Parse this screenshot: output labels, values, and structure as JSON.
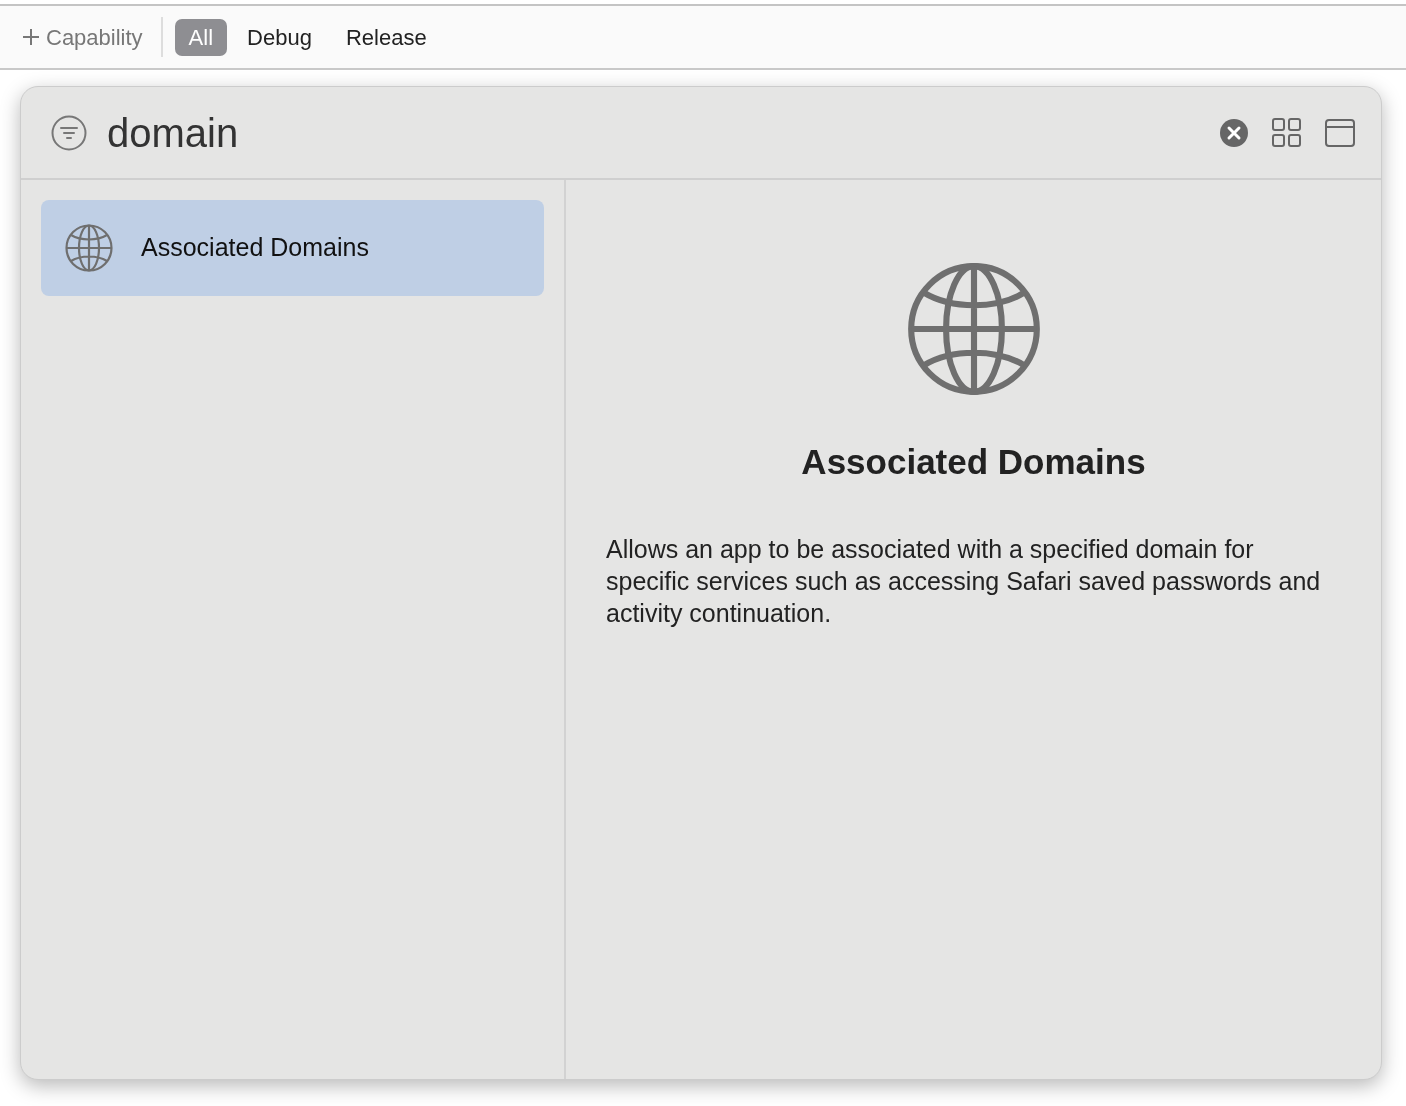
{
  "toolbar": {
    "add_button": "Capability",
    "filters": [
      {
        "label": "All",
        "selected": true
      },
      {
        "label": "Debug",
        "selected": false
      },
      {
        "label": "Release",
        "selected": false
      }
    ]
  },
  "library": {
    "search": {
      "value": "domain"
    },
    "results": [
      {
        "label": "Associated Domains",
        "selected": true
      }
    ],
    "detail": {
      "title": "Associated Domains",
      "description": "Allows an app to be associated with a specified domain for specific services such as accessing Safari saved passwords and activity continuation."
    }
  }
}
